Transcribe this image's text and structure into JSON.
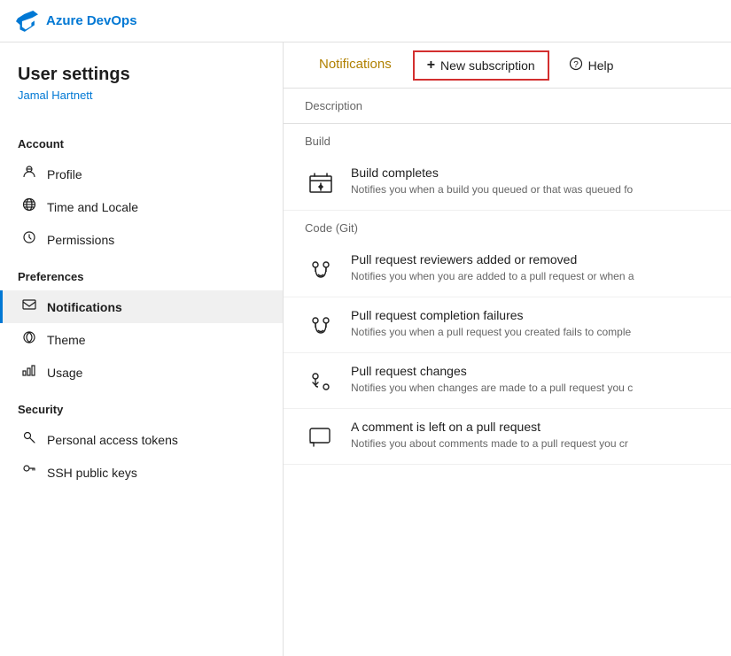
{
  "topbar": {
    "logo_text": "Azure DevOps",
    "logo_icon": "azure-devops"
  },
  "sidebar": {
    "title": "User settings",
    "subtitle": "Jamal Hartnett",
    "sections": [
      {
        "label": "Account",
        "items": [
          {
            "id": "profile",
            "label": "Profile",
            "icon": "👤"
          },
          {
            "id": "time-locale",
            "label": "Time and Locale",
            "icon": "🌐"
          },
          {
            "id": "permissions",
            "label": "Permissions",
            "icon": "⟳"
          }
        ]
      },
      {
        "label": "Preferences",
        "items": [
          {
            "id": "notifications",
            "label": "Notifications",
            "icon": "💬",
            "active": true
          },
          {
            "id": "theme",
            "label": "Theme",
            "icon": "🎨"
          },
          {
            "id": "usage",
            "label": "Usage",
            "icon": "📊"
          }
        ]
      },
      {
        "label": "Security",
        "items": [
          {
            "id": "personal-access-tokens",
            "label": "Personal access tokens",
            "icon": "🔑"
          },
          {
            "id": "ssh-public-keys",
            "label": "SSH public keys",
            "icon": "🔐"
          }
        ]
      }
    ]
  },
  "content": {
    "tab_label": "Notifications",
    "new_subscription_label": "New subscription",
    "help_label": "Help",
    "table_header": "Description",
    "groups": [
      {
        "label": "Build",
        "items": [
          {
            "id": "build-completes",
            "title": "Build completes",
            "description": "Notifies you when a build you queued or that was queued fo",
            "icon_type": "build"
          }
        ]
      },
      {
        "label": "Code (Git)",
        "items": [
          {
            "id": "pr-reviewers",
            "title": "Pull request reviewers added or removed",
            "description": "Notifies you when you are added to a pull request or when a",
            "icon_type": "pr"
          },
          {
            "id": "pr-completion-failures",
            "title": "Pull request completion failures",
            "description": "Notifies you when a pull request you created fails to comple",
            "icon_type": "pr"
          },
          {
            "id": "pr-changes",
            "title": "Pull request changes",
            "description": "Notifies you when changes are made to a pull request you c",
            "icon_type": "pr-arrow"
          },
          {
            "id": "pr-comment",
            "title": "A comment is left on a pull request",
            "description": "Notifies you about comments made to a pull request you cr",
            "icon_type": "comment"
          }
        ]
      }
    ]
  },
  "colors": {
    "azure_blue": "#0078d4",
    "active_border": "#0078d4",
    "new_sub_border": "#d32f2f",
    "tab_color": "#b08000"
  }
}
